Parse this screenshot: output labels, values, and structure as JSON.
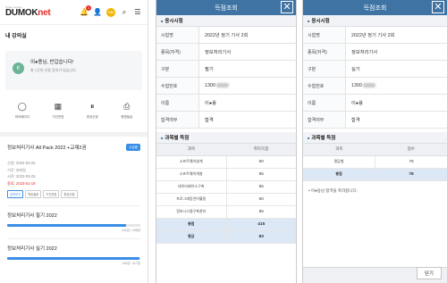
{
  "panel1": {
    "logo_tag": "Smart Lecture",
    "logo_text_main": "DUMOK",
    "logo_text_accent": "net",
    "notif_count": "1",
    "cn_badge": "CN",
    "section_title": "내 강의실",
    "greet_initial": "K",
    "greet_text": "이●용님, 반갑습니다!",
    "greet_sub": "총 1건의 신청 강의가 있습니다.",
    "menu": [
      {
        "label": "마이페이지",
        "icon": "user-icon"
      },
      {
        "label": "기간연장",
        "icon": "calendar-icon"
      },
      {
        "label": "휴강신청",
        "icon": "pause-icon"
      },
      {
        "label": "증명발급",
        "icon": "printer-icon"
      }
    ],
    "course_title": "정보처리기사 All Pack 2022 +교재2권",
    "course_tag": "수강중",
    "course_meta": [
      "신청: 2022-03-25",
      "기간: 300일",
      "시작: 2022-03-25"
    ],
    "course_end": "종료: 2023-01-19",
    "chips": [
      "강의보기",
      "학습질문",
      "기간연장",
      "휴강신청"
    ],
    "progress": [
      {
        "title": "정보처리기사 필기 2022",
        "value": "141강 / 158강",
        "ratio": 0.89
      },
      {
        "title": "정보처리기사 실기 2022",
        "value": "116강 / 117강",
        "ratio": 0.99
      }
    ]
  },
  "panel2": {
    "header_title": "득점조회",
    "section_info": "응시시험",
    "rows": [
      {
        "k": "시험명",
        "v": "2022년 정기 기사 2회"
      },
      {
        "k": "종목(자격)",
        "v": "정보처리기사"
      },
      {
        "k": "구분",
        "v": "필기"
      },
      {
        "k": "수험번호",
        "v": "1300"
      },
      {
        "k": "이름",
        "v": "이●용"
      },
      {
        "k": "합격여부",
        "v": "합격"
      }
    ],
    "section_score": "과목별 득점",
    "col_subject": "과목",
    "col_score": "취득득점",
    "scores": [
      {
        "subject": "소프트웨어설계",
        "score": "80"
      },
      {
        "subject": "소프트웨어개발",
        "score": "85"
      },
      {
        "subject": "데이터베이스구축",
        "score": "85"
      },
      {
        "subject": "프로그래밍언어활용",
        "score": "80"
      },
      {
        "subject": "정보시스템구축관리",
        "score": "85"
      }
    ],
    "total_label": "총점",
    "total_value": "415",
    "avg_label": "평균",
    "avg_value": "83"
  },
  "panel3": {
    "header_title": "득점조회",
    "section_info": "응시시험",
    "rows": [
      {
        "k": "시험명",
        "v": "2022년 정기 기사 2회"
      },
      {
        "k": "종목(자격)",
        "v": "정보처리기사"
      },
      {
        "k": "구분",
        "v": "실기"
      },
      {
        "k": "수험번호",
        "v": "1300"
      },
      {
        "k": "이름",
        "v": "이●용"
      },
      {
        "k": "합격여부",
        "v": "합격"
      }
    ],
    "section_score": "과목별 득점",
    "col_subject": "과목",
    "col_score": "점수",
    "scores": [
      {
        "subject": "필답형",
        "score": "78"
      }
    ],
    "total_label": "총점",
    "total_value": "78",
    "note": "이●용님 합격을 축하합니다.",
    "close_label": "닫기"
  },
  "colors": {
    "header_blue": "#3e73a4",
    "accent_red": "#e62b2b",
    "accent_blue": "#3a8ee6",
    "highlight_row": "#dce8f6"
  }
}
